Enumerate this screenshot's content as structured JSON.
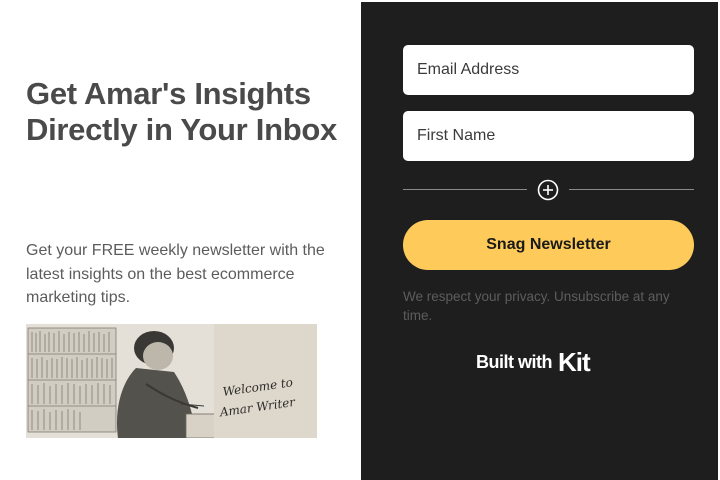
{
  "left": {
    "headline": "Get Amar's Insights Directly in Your Inbox",
    "subtext": "Get your FREE weekly newsletter with the latest insights on the best ecommerce marketing tips.",
    "image_text": "Welcome to Amar Writer"
  },
  "form": {
    "email_placeholder": "Email Address",
    "first_name_placeholder": "First Name",
    "submit_label": "Snag Newsletter",
    "privacy_text": "We respect your privacy. Unsubscribe at any time.",
    "built_with_label": "Built with",
    "brand_name": "Kit"
  },
  "colors": {
    "panel_bg": "#1e1e1e",
    "button_bg": "#fecb5a",
    "headline": "#4a4a4a"
  },
  "icons": [
    "plus-circle-icon",
    "kit-logo"
  ]
}
